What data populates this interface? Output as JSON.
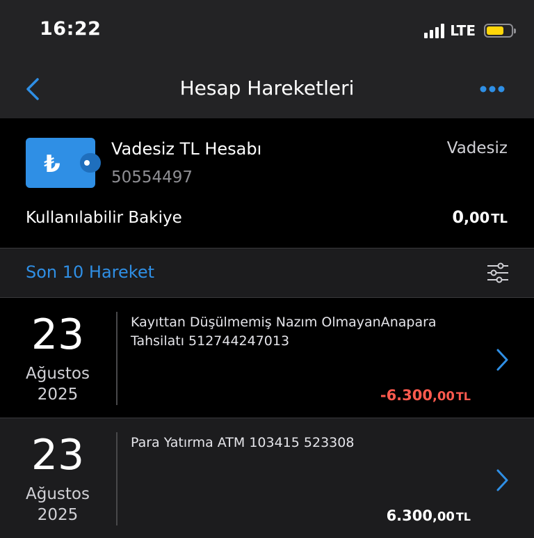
{
  "status_bar": {
    "time": "16:22",
    "network": "LTE"
  },
  "nav": {
    "title": "Hesap Hareketleri"
  },
  "account": {
    "name": "Vadesiz TL Hesabı",
    "number": "50554497",
    "type": "Vadesiz",
    "balance_label": "Kullanılabilir Bakiye",
    "balance_main": "0",
    "balance_cents": ",00",
    "balance_currency": "TL",
    "currency_symbol": "₺"
  },
  "section": {
    "title": "Son 10 Hareket"
  },
  "transactions": [
    {
      "day": "23",
      "month": "Ağustos",
      "year": "2025",
      "description": "Kayıttan Düşülmemiş Nazım OlmayanAnapara Tahsilatı 512744247013",
      "amount_main": "-6.300",
      "amount_cents": ",00",
      "currency": "TL"
    },
    {
      "day": "23",
      "month": "Ağustos",
      "year": "2025",
      "description": "Para Yatırma ATM 103415 523308",
      "amount_main": "6.300",
      "amount_cents": ",00",
      "currency": "TL"
    }
  ],
  "colors": {
    "accent": "#2f8fe5",
    "negative": "#ff5a4e",
    "battery": "#ffd60a",
    "background": "#1c1c1e"
  },
  "icons": {
    "back": "chevron-left-icon",
    "more": "more-dots-icon",
    "wallet": "wallet-icon",
    "filter": "filter-sliders-icon",
    "row_chevron": "chevron-right-icon"
  }
}
